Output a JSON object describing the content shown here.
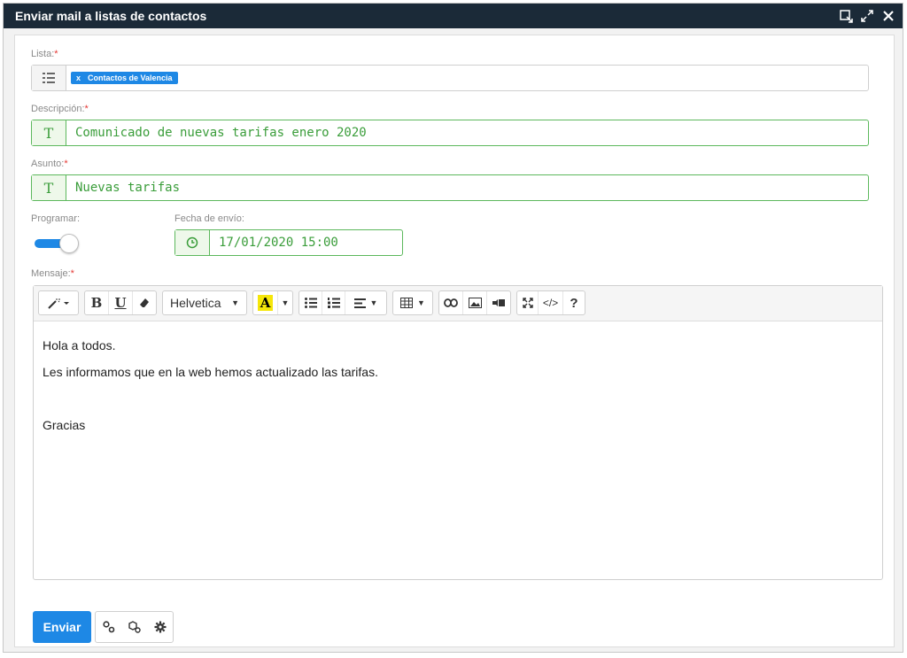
{
  "window": {
    "title": "Enviar mail a listas de contactos"
  },
  "form": {
    "lista": {
      "label": "Lista:",
      "required": "*",
      "tag_remove": "x",
      "tag_text": "Contactos de Valencia"
    },
    "descripcion": {
      "label": "Descripción:",
      "required": "*",
      "value": "Comunicado de nuevas tarifas enero 2020"
    },
    "asunto": {
      "label": "Asunto:",
      "required": "*",
      "value": "Nuevas tarifas"
    },
    "programar": {
      "label": "Programar:",
      "enabled": true
    },
    "fecha": {
      "label": "Fecha de envío:",
      "value": "17/01/2020 15:00"
    },
    "mensaje": {
      "label": "Mensaje:",
      "required": "*",
      "font": "Helvetica",
      "toolbar": {
        "bold": "B",
        "underline": "U",
        "highlight": "A",
        "help": "?",
        "code": "</>"
      },
      "lines": [
        "Hola a todos.",
        "Les informamos que en la web hemos actualizado las tarifas.",
        "",
        "Gracias"
      ]
    }
  },
  "footer": {
    "send_label": "Enviar"
  },
  "colors": {
    "titlebar": "#1b2a38",
    "accent": "#1e88e5",
    "valid": "#5cb85c",
    "required": "#e53935"
  }
}
